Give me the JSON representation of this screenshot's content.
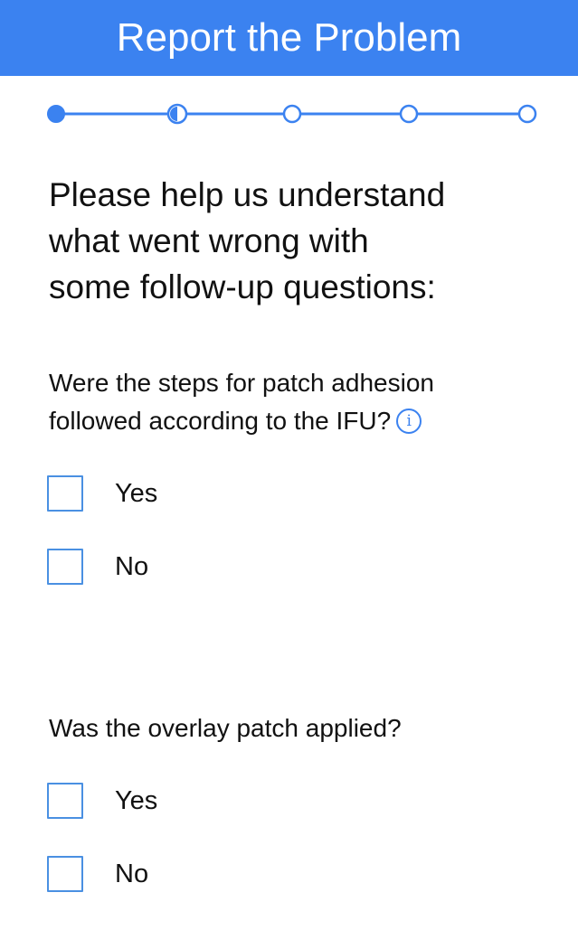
{
  "header": {
    "title": "Report the Problem"
  },
  "stepper": {
    "total_steps": 5,
    "current_step": 2,
    "completed_steps": 1,
    "accent_color": "#3b82f0"
  },
  "intro": {
    "heading_line1": "Please help us understand",
    "heading_line2": "what went wrong with",
    "heading_line3": "some follow-up questions:"
  },
  "questions": [
    {
      "line1": "Were the steps for patch adhesion",
      "line2": "followed according to the IFU?",
      "info_icon": "info-icon",
      "options": [
        {
          "label": "Yes",
          "checked": false
        },
        {
          "label": "No",
          "checked": false
        }
      ]
    },
    {
      "line1": "Was the overlay patch applied?",
      "options": [
        {
          "label": "Yes",
          "checked": false
        },
        {
          "label": "No",
          "checked": false
        }
      ]
    }
  ]
}
